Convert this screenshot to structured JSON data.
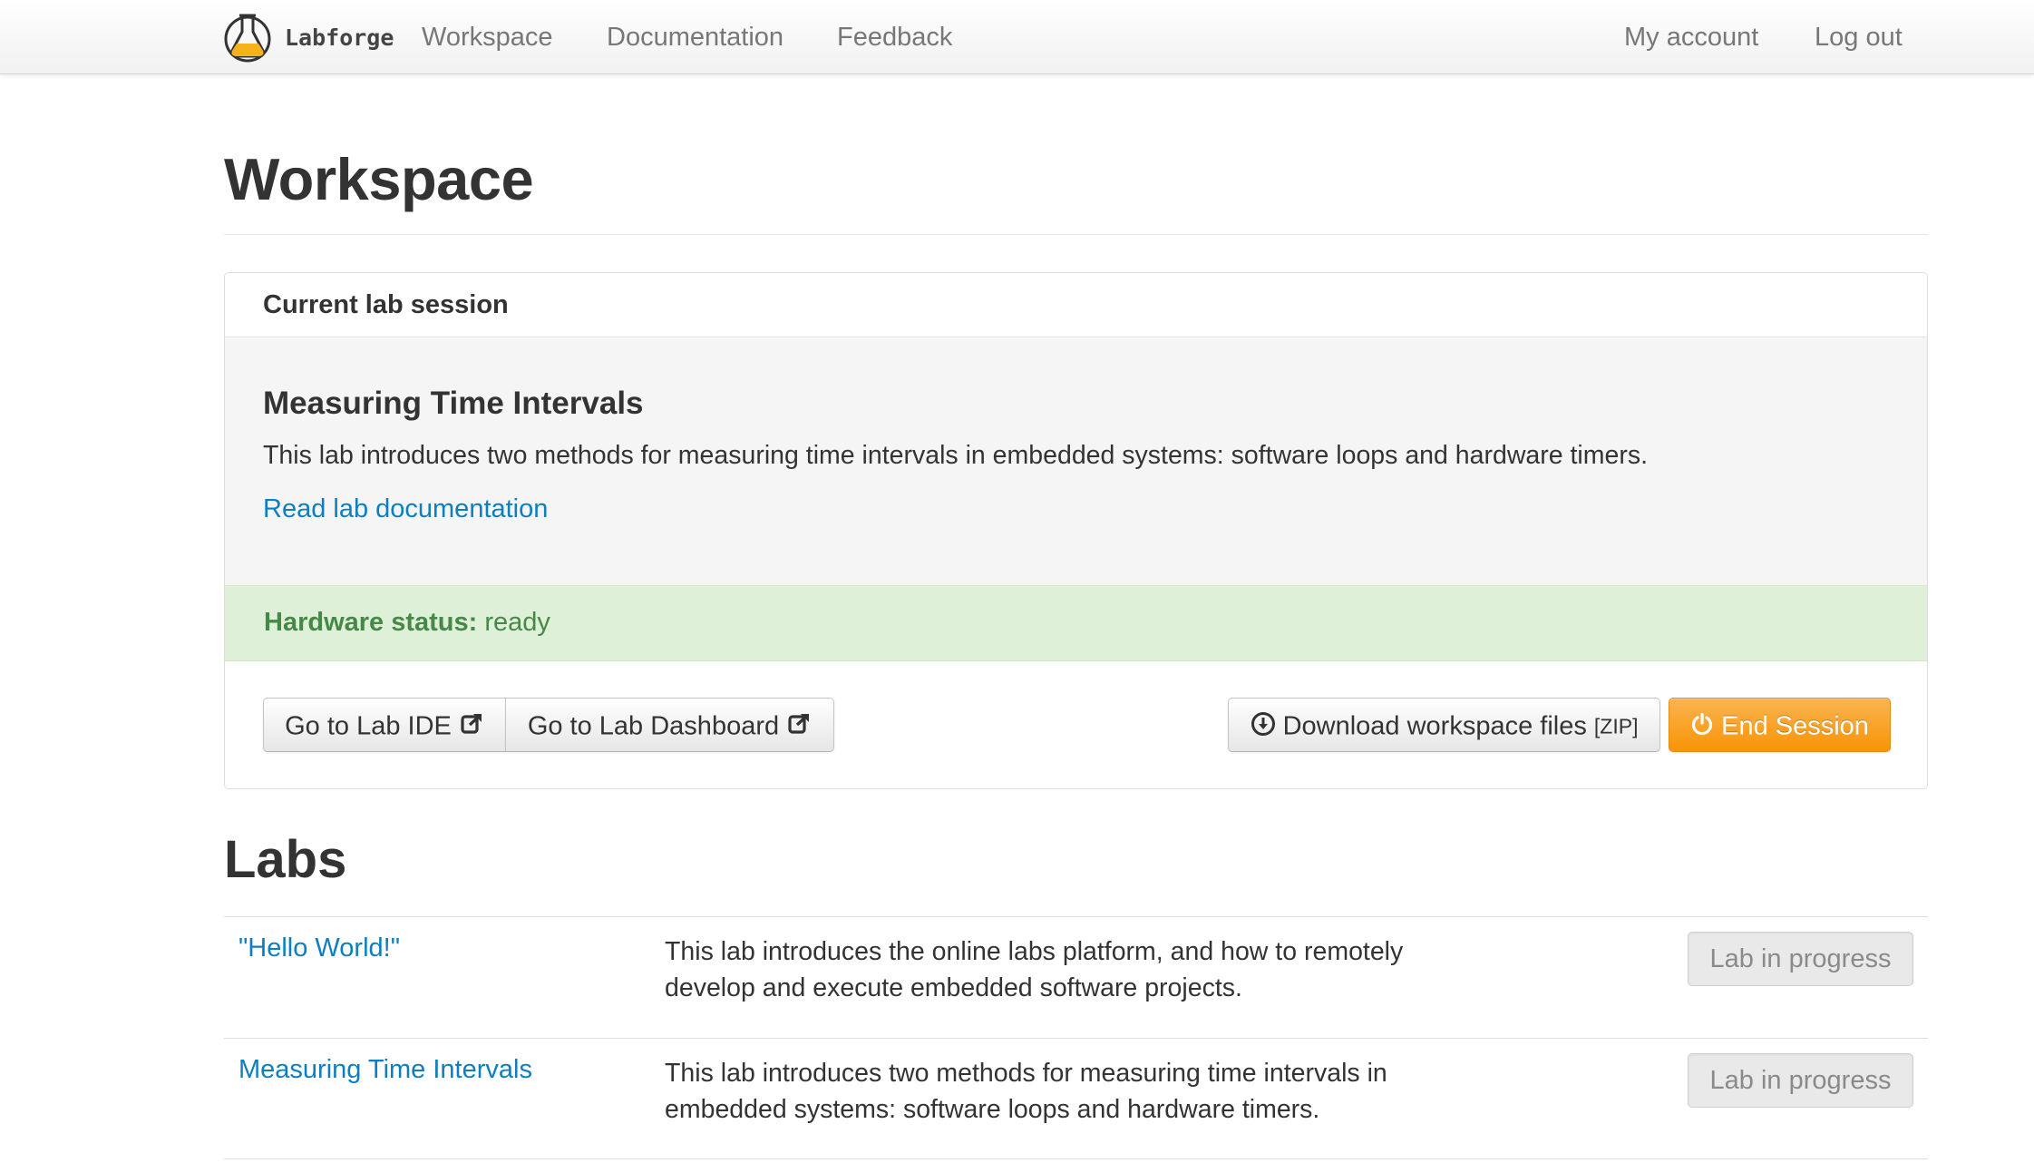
{
  "navbar": {
    "brand": "Labforge",
    "links": [
      "Workspace",
      "Documentation",
      "Feedback"
    ],
    "right_links": [
      "My account",
      "Log out"
    ]
  },
  "page": {
    "title": "Workspace"
  },
  "session": {
    "heading": "Current lab session",
    "lab_title": "Measuring Time Intervals",
    "lab_description": "This lab introduces two methods for measuring time intervals in embedded systems: software loops and hardware timers.",
    "doc_link": "Read lab documentation",
    "hardware_status_label": "Hardware status:",
    "hardware_status_value": "ready",
    "buttons": {
      "ide": "Go to Lab IDE",
      "dashboard": "Go to Lab Dashboard",
      "download": "Download workspace files",
      "download_suffix": "[ZIP]",
      "end": "End Session"
    }
  },
  "labs": {
    "title": "Labs",
    "rows": [
      {
        "name": "\"Hello World!\"",
        "desc_line1": "This lab introduces the online labs platform, and how to remotely",
        "desc_line2": "develop and execute embedded software projects.",
        "status": "Lab in progress"
      },
      {
        "name": "Measuring Time Intervals",
        "desc_line1": "This lab introduces two methods for measuring time intervals in",
        "desc_line2": "embedded systems: software loops and hardware timers.",
        "status": "Lab in progress"
      }
    ]
  },
  "colors": {
    "link": "#0e7ec0",
    "success_bg": "#dff0d8",
    "success_text": "#468847",
    "warning": "#f89406"
  }
}
